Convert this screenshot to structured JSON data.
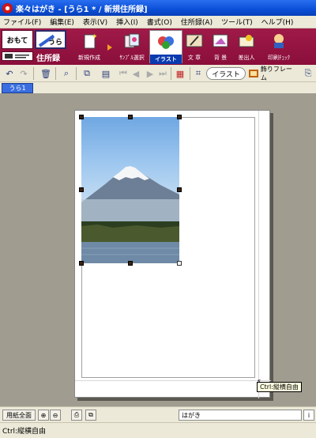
{
  "window": {
    "title": "楽々はがき - [うら1 * / 新規住所録]"
  },
  "menu": [
    "ファイル(F)",
    "編集(E)",
    "表示(V)",
    "挿入(I)",
    "書式(O)",
    "住所録(A)",
    "ツール(T)",
    "ヘルプ(H)"
  ],
  "side_switch": {
    "omote": "おもて",
    "ura": "うら",
    "address_label": "住所録"
  },
  "big_toolbar": [
    {
      "label": "新規作成",
      "icon": "new-doc-icon"
    },
    {
      "label": "ｻﾝﾌﾟﾙ選択",
      "icon": "sample-select-icon"
    },
    {
      "label": "イラスト",
      "icon": "illustration-icon",
      "active": true
    },
    {
      "label": "文 章",
      "icon": "text-icon"
    },
    {
      "label": "背 景",
      "icon": "background-icon"
    },
    {
      "label": "差出人",
      "icon": "sender-icon"
    },
    {
      "label": "印刷ﾁｪｯｸ",
      "icon": "print-check-icon"
    }
  ],
  "small_toolbar": {
    "illust_pill": "イラスト",
    "frame_label": "飾りフレーム"
  },
  "doc_tab": "うら1",
  "tooltip": "Ctrl:縦横自由",
  "zoom_bar": {
    "fit_label": "用紙全面",
    "paper_label": "はがき"
  },
  "status": "Ctrl:縦横自由",
  "colors": {
    "toolbar_bg": "#8a0e3a",
    "titlebar": "#0a4fd6",
    "canvas_bg": "#a09c90",
    "active_label": "#0a3ab0"
  }
}
